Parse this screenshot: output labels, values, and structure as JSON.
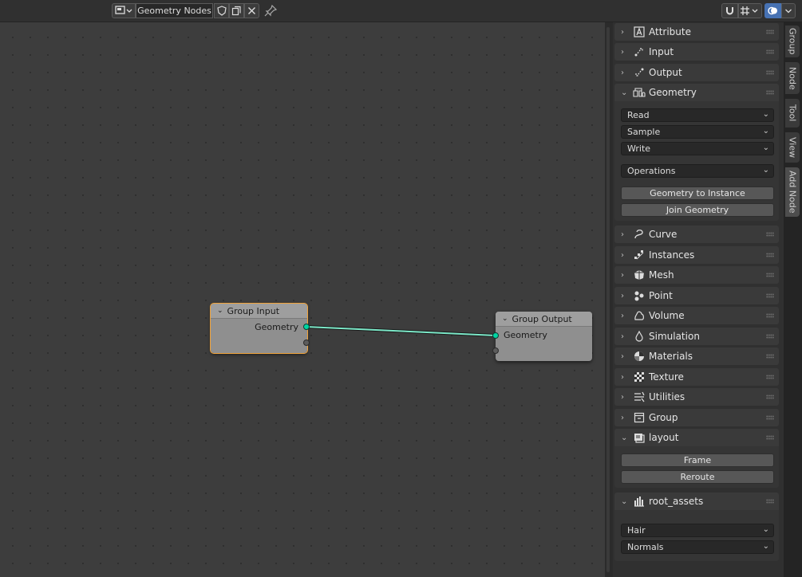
{
  "header": {
    "editor_name": "Geometry Nodes"
  },
  "canvas": {
    "nodes": [
      {
        "title": "Group Input",
        "socket": "Geometry"
      },
      {
        "title": "Group Output",
        "socket": "Geometry"
      }
    ]
  },
  "sidebar": {
    "panels": [
      {
        "label": "Attribute",
        "expanded": false,
        "icon": "attribute-icon"
      },
      {
        "label": "Input",
        "expanded": false,
        "icon": "input-icon"
      },
      {
        "label": "Output",
        "expanded": false,
        "icon": "output-icon"
      },
      {
        "label": "Geometry",
        "expanded": true,
        "icon": "geometry-icon",
        "dropdowns": [
          "Read",
          "Sample",
          "Write",
          "Operations"
        ],
        "buttons": [
          "Geometry to Instance",
          "Join Geometry"
        ]
      },
      {
        "label": "Curve",
        "expanded": false,
        "icon": "curve-icon"
      },
      {
        "label": "Instances",
        "expanded": false,
        "icon": "instances-icon"
      },
      {
        "label": "Mesh",
        "expanded": false,
        "icon": "mesh-icon"
      },
      {
        "label": "Point",
        "expanded": false,
        "icon": "point-icon"
      },
      {
        "label": "Volume",
        "expanded": false,
        "icon": "volume-icon"
      },
      {
        "label": "Simulation",
        "expanded": false,
        "icon": "simulation-icon"
      },
      {
        "label": "Materials",
        "expanded": false,
        "icon": "materials-icon"
      },
      {
        "label": "Texture",
        "expanded": false,
        "icon": "texture-icon"
      },
      {
        "label": "Utilities",
        "expanded": false,
        "icon": "utilities-icon"
      },
      {
        "label": "Group",
        "expanded": false,
        "icon": "group-icon"
      },
      {
        "label": "layout",
        "expanded": true,
        "icon": "layout-icon",
        "buttons": [
          "Frame",
          "Reroute"
        ]
      },
      {
        "label": "root_assets",
        "expanded": true,
        "icon": "assets-icon",
        "dropdowns": [
          "Hair",
          "Normals"
        ]
      }
    ]
  },
  "tabs": [
    "Group",
    "Node",
    "Tool",
    "View",
    "Add Node"
  ],
  "active_tab": "Add Node",
  "colors": {
    "geometry_socket": "#00d6a3",
    "selection": "#f0a33a",
    "active_blue": "#4772b3"
  }
}
